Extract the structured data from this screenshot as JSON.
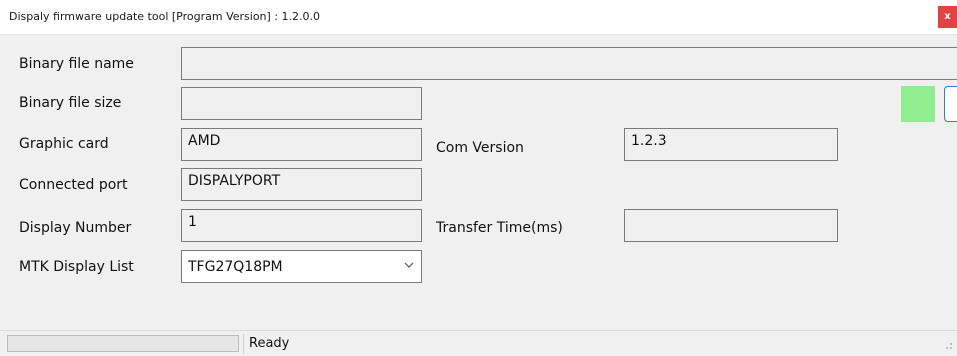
{
  "window": {
    "title": "Dispaly firmware update tool [Program Version] : 1.2.0.0",
    "close_label": "x"
  },
  "form": {
    "binary_file_name": {
      "label": "Binary file name",
      "value": ""
    },
    "binary_file_size": {
      "label": "Binary file size",
      "value": ""
    },
    "graphic_card": {
      "label": "Graphic card",
      "value": "AMD"
    },
    "connected_port": {
      "label": "Connected port",
      "value": "DISPALYPORT"
    },
    "display_number": {
      "label": "Display Number",
      "value": "1"
    },
    "mtk_display_list": {
      "label": "MTK Display List",
      "selected": "TFG27Q18PM"
    },
    "com_version": {
      "label": "Com Version",
      "value": "1.2.3"
    },
    "transfer_time": {
      "label": "Transfer Time(ms)",
      "value": ""
    }
  },
  "status_indicator": {
    "color": "#90ee90"
  },
  "statusbar": {
    "progress": 0,
    "text": "Ready"
  }
}
